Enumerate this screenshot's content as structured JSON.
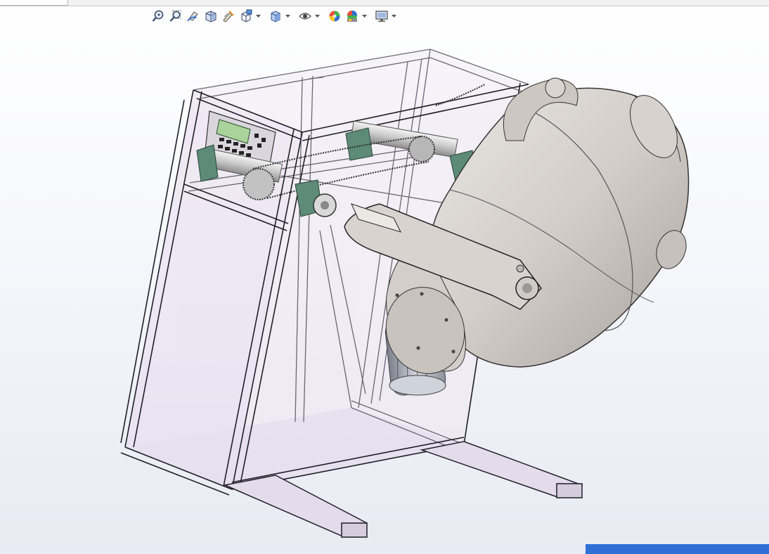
{
  "window": {
    "menu_fragment": "...",
    "accent": "#2f6fd6"
  },
  "heads_up_toolbar": {
    "tools": [
      {
        "id": "zoom-to-fit",
        "icon": "zoom-to-fit-icon"
      },
      {
        "id": "zoom-to-area",
        "icon": "zoom-to-area-icon"
      },
      {
        "id": "previous-view",
        "icon": "previous-view-icon"
      },
      {
        "id": "section-view",
        "icon": "section-view-icon"
      },
      {
        "id": "dynamic-annotation",
        "icon": "dynamic-annotation-icon"
      },
      {
        "id": "view-orientation",
        "icon": "view-orientation-icon",
        "dropdown": true
      },
      {
        "id": "display-style",
        "icon": "display-style-icon",
        "dropdown": true
      },
      {
        "id": "hide-show-items",
        "icon": "eye-icon",
        "dropdown": true
      },
      {
        "id": "edit-appearance",
        "icon": "appearance-icon"
      },
      {
        "id": "apply-scene",
        "icon": "scene-icon",
        "dropdown": true
      },
      {
        "id": "view-settings",
        "icon": "monitor-icon",
        "dropdown": true
      }
    ]
  },
  "model": {
    "description_hidden": true,
    "colors": {
      "frame_line": "#2b2b33",
      "panel_fill": "#e9ddef",
      "drum": "#cfcac6",
      "drum_dark": "#a9a39f",
      "bearing_green": "#5d8b78",
      "motor": "#b9bcc6",
      "lcd": "#a9d39b"
    }
  }
}
